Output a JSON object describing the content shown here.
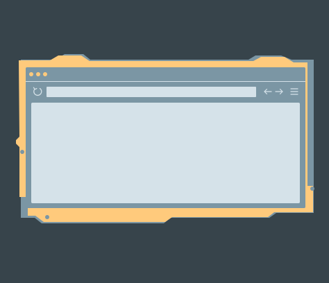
{
  "theme": {
    "background": "#37444b",
    "frame_accent": "#ffca7c",
    "window_chrome": "#7b96a4",
    "content_surface": "#d5e2e9"
  },
  "window": {
    "controls": [
      "close-dot",
      "minimize-dot",
      "maximize-dot"
    ],
    "address_bar": {
      "value": "",
      "placeholder": ""
    },
    "icons": {
      "reload": "reload-icon",
      "back": "arrow-left-icon",
      "forward": "arrow-right-icon",
      "menu": "hamburger-menu-icon"
    }
  }
}
